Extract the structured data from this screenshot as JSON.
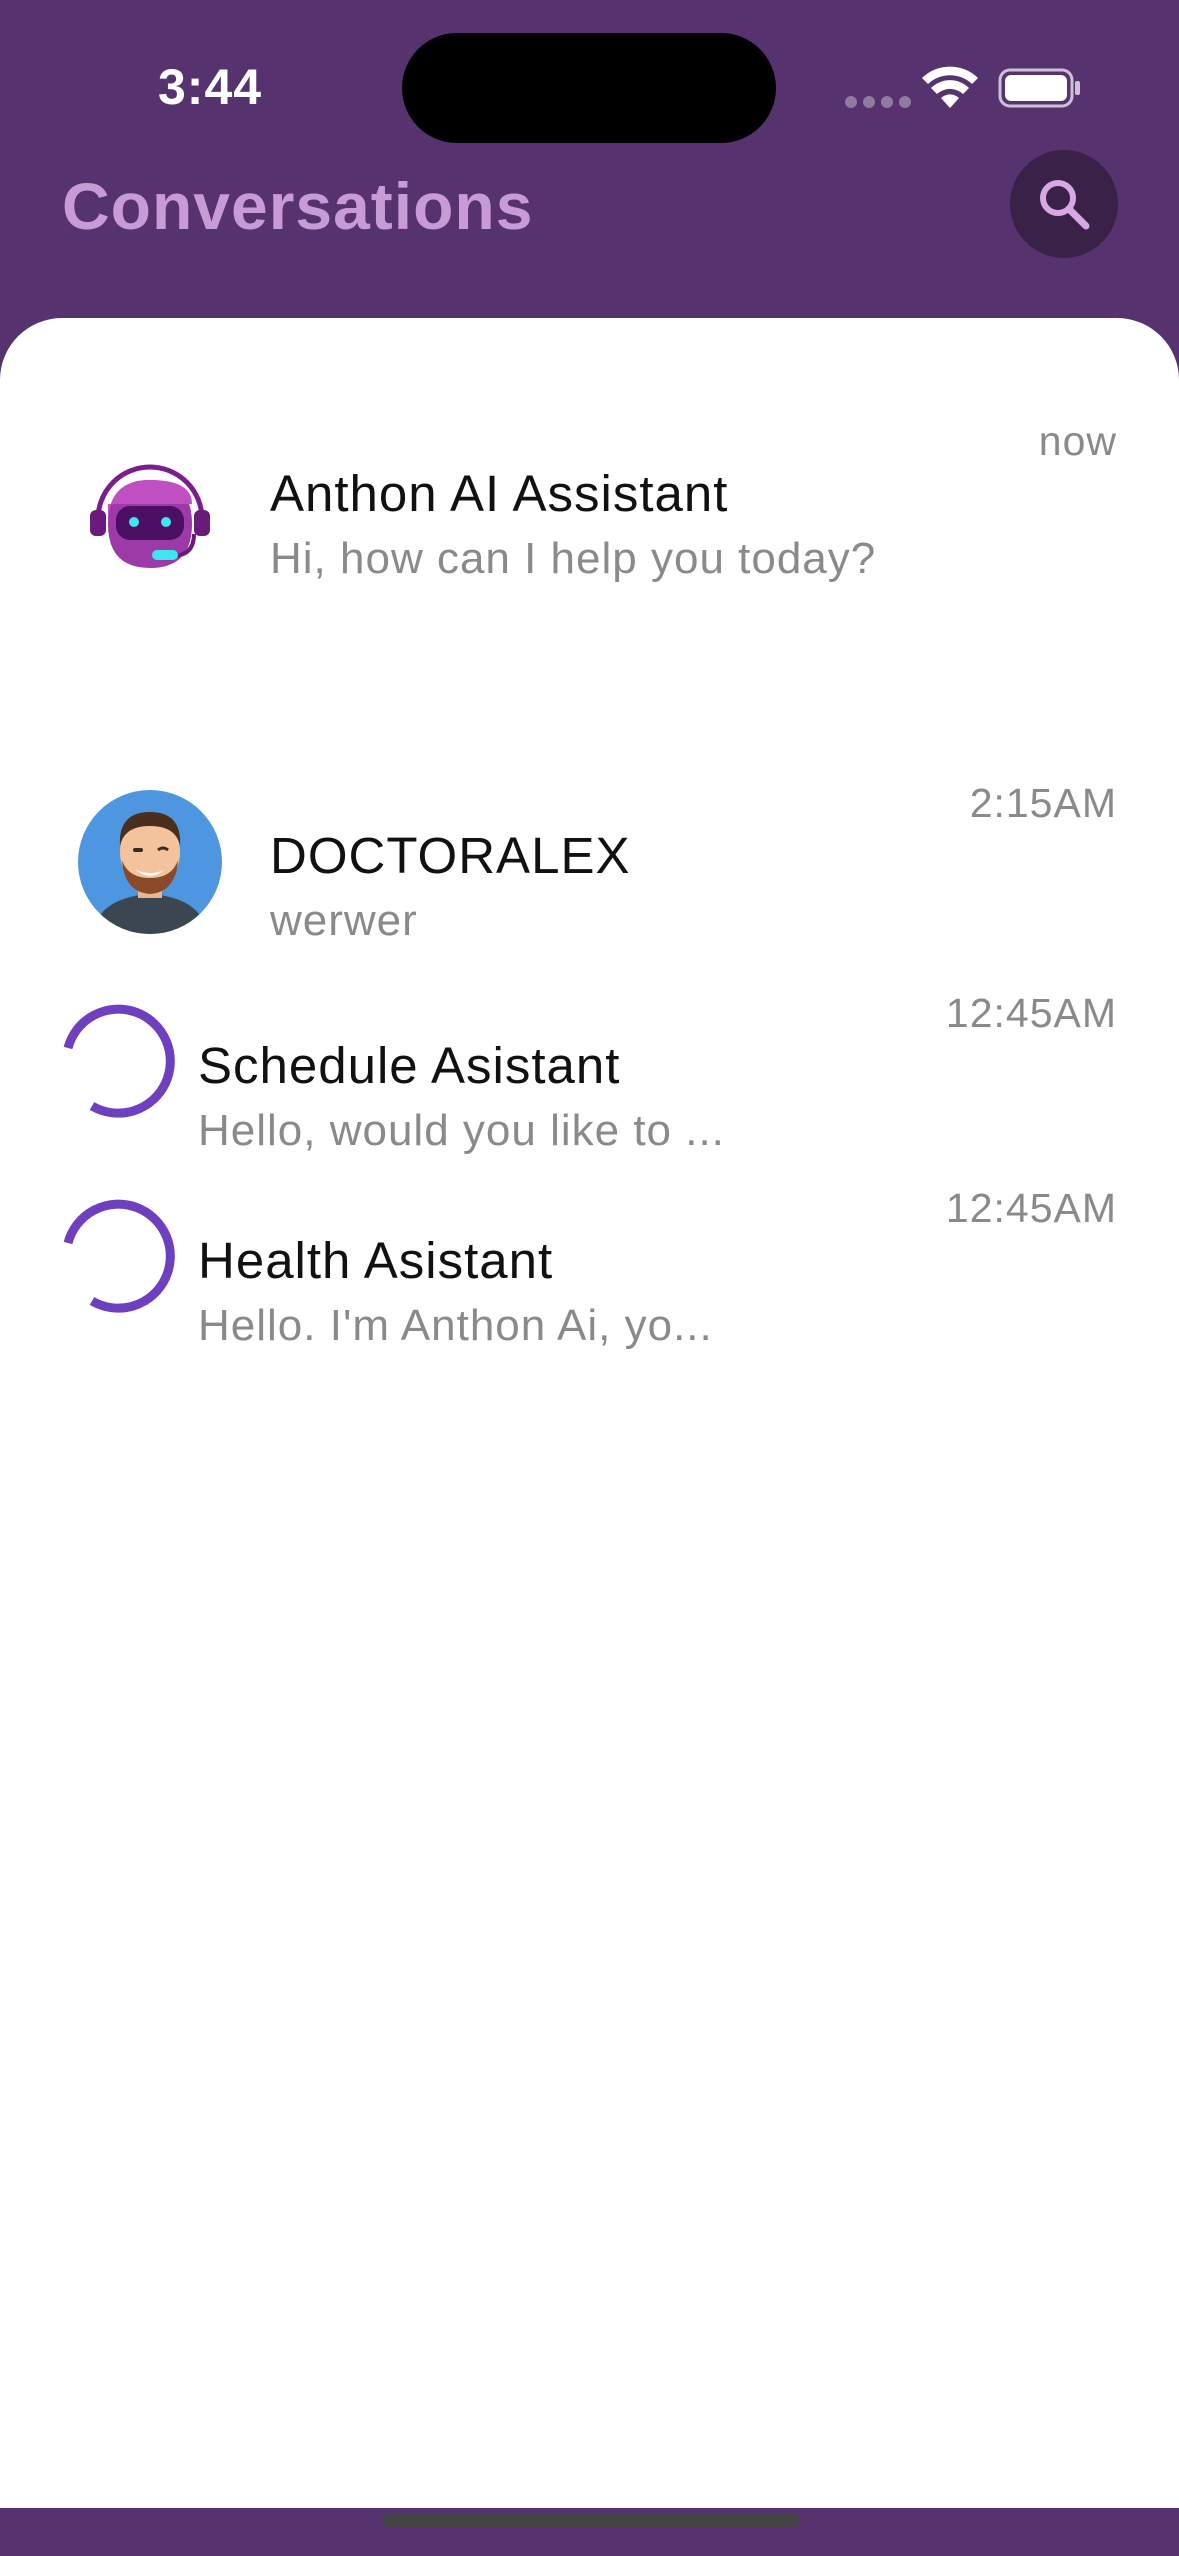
{
  "status_bar": {
    "time": "3:44"
  },
  "header": {
    "title": "Conversations"
  },
  "conversations": [
    {
      "name": "Anthon AI Assistant",
      "preview": "Hi, how can I help you today?",
      "time": "now",
      "avatar": "robot-avatar"
    },
    {
      "name": "DOCTORALEX",
      "preview": "werwer",
      "time": "2:15AM",
      "avatar": "doctor-avatar"
    },
    {
      "name": "Schedule Asistant",
      "preview": "Hello, would you like to ...",
      "time": "12:45AM",
      "avatar": "loading-spinner"
    },
    {
      "name": "Health Asistant",
      "preview": "Hello. I'm Anthon Ai, yo...",
      "time": "12:45AM",
      "avatar": "loading-spinner"
    }
  ],
  "colors": {
    "header_bg": "#56336F",
    "title": "#C99BD6",
    "accent": "#6E3FBF",
    "muted_text": "#8A8A8A"
  }
}
